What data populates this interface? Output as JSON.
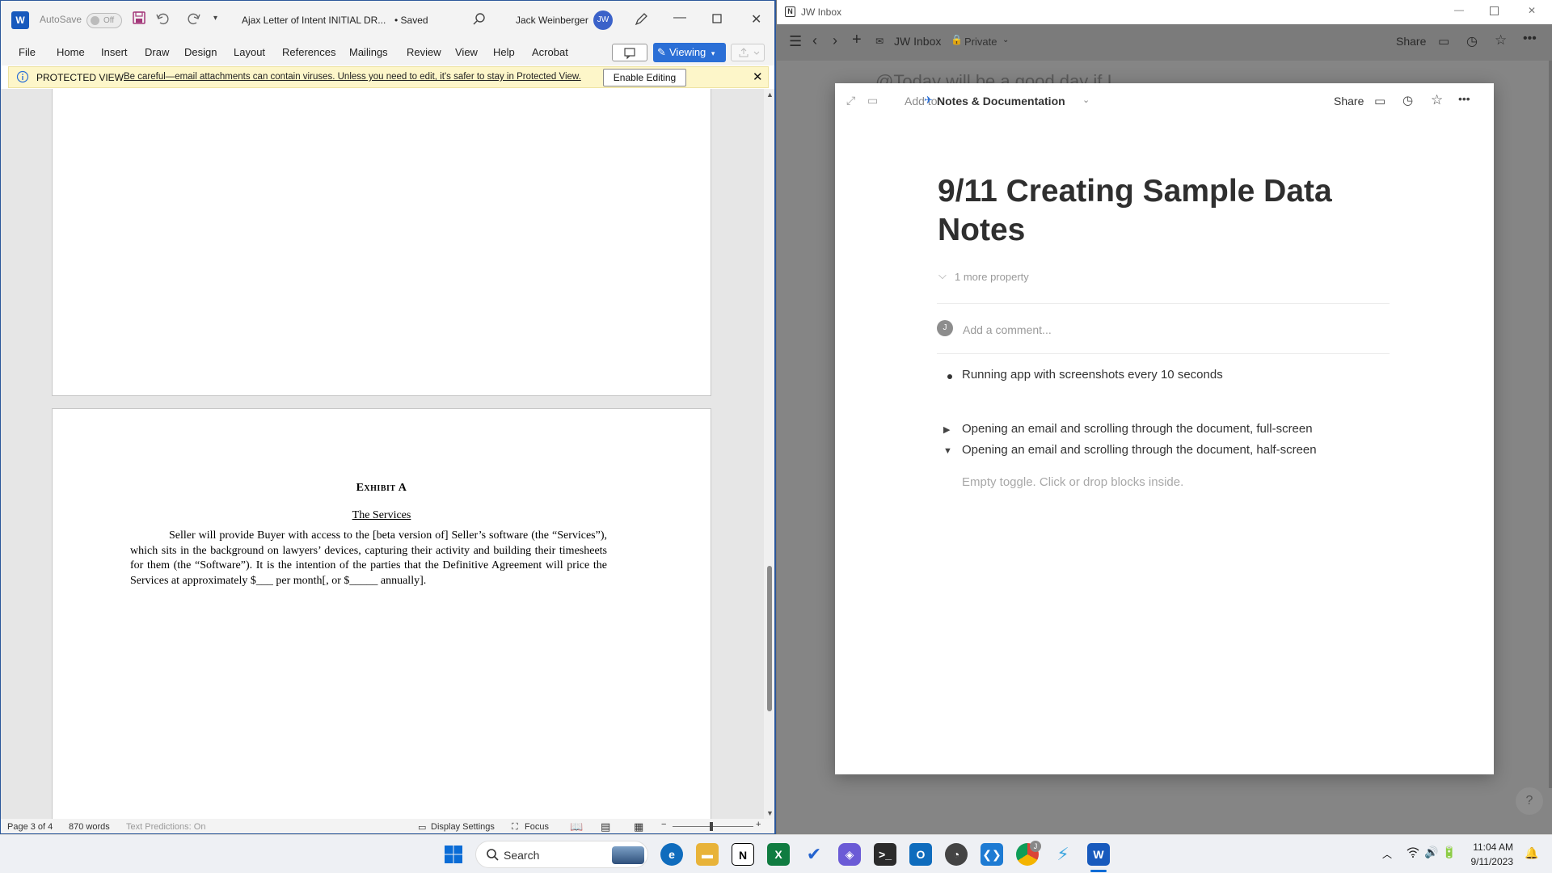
{
  "word": {
    "autosave_label": "AutoSave",
    "autosave_state": "Off",
    "doc_title": "Ajax Letter of Intent INITIAL DR...",
    "saved_status": "• Saved",
    "user_name": "Jack Weinberger",
    "user_initials": "JW",
    "menu": [
      "File",
      "Home",
      "Insert",
      "Draw",
      "Design",
      "Layout",
      "References",
      "Mailings",
      "Review",
      "View",
      "Help",
      "Acrobat"
    ],
    "viewing_label": "Viewing",
    "protected_label": "PROTECTED VIEW",
    "protected_message": "Be careful—email attachments can contain viruses. Unless you need to edit, it's safer to stay in Protected View.",
    "enable_editing": "Enable Editing",
    "exhibit_heading": "Exhibit A",
    "services_heading": "The Services",
    "services_body": "Seller will provide Buyer with access to the [beta version of] Seller’s software (the “Services”), which sits in the background on lawyers’ devices, capturing their activity and building their timesheets for them (the “Software”). It is the intention of the parties that the Definitive Agreement will price the Services at approximately $___ per month[, or $_____ annually].",
    "status": {
      "page": "Page 3 of 4",
      "words": "870 words",
      "predictions": "Text Predictions: On",
      "display_settings": "Display Settings",
      "focus": "Focus"
    }
  },
  "notion": {
    "window_title": "JW Inbox",
    "breadcrumb": "JW Inbox",
    "privacy": "Private",
    "share_label": "Share",
    "behind_text": "@Today will be a good day if I",
    "add_to": "Add to",
    "workspace": "Notes & Documentation",
    "page_title": "9/11 Creating Sample Data Notes",
    "more_property": "1 more property",
    "comment_initial": "J",
    "comment_placeholder": "Add a comment...",
    "bullet": "Running app with screenshots every 10 seconds",
    "toggles": [
      {
        "label": "Opening an email and scrolling through the document, full-screen",
        "open": false
      },
      {
        "label": "Opening an email and scrolling through the document, half-screen",
        "open": true
      }
    ],
    "empty_toggle": "Empty toggle. Click or drop blocks inside.",
    "help": "?"
  },
  "taskbar": {
    "search_label": "Search",
    "time": "11:04 AM",
    "date": "9/11/2023",
    "chrome_badge": "J"
  },
  "colors": {
    "word_blue": "#2b579a",
    "viewing_blue": "#2b6fd6",
    "protected_bg": "#fdf6c9",
    "notion_overlay": "#858585"
  }
}
